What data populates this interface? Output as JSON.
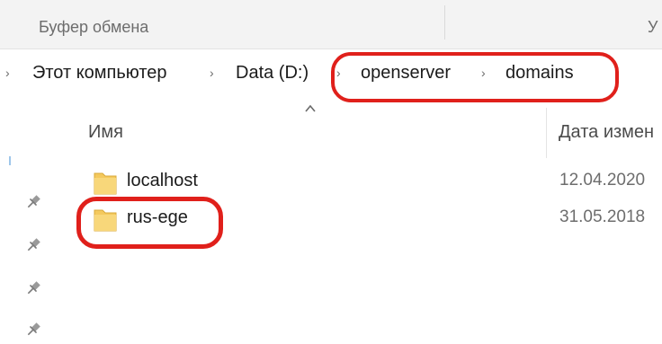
{
  "ribbon": {
    "group_label": "Буфер обмена",
    "right_label": "У"
  },
  "breadcrumb": {
    "items": [
      "Этот компьютер",
      "Data (D:)",
      "openserver",
      "domains"
    ]
  },
  "columns": {
    "name": "Имя",
    "date": "Дата измен"
  },
  "files": [
    {
      "name": "localhost",
      "date": "12.04.2020"
    },
    {
      "name": "rus-ege",
      "date": "31.05.2018"
    }
  ],
  "colors": {
    "highlight": "#e0201b",
    "folder": "#f4c95d"
  },
  "icons": [
    "chevron-right-icon",
    "sort-up-icon",
    "folder-icon",
    "pin-icon"
  ]
}
